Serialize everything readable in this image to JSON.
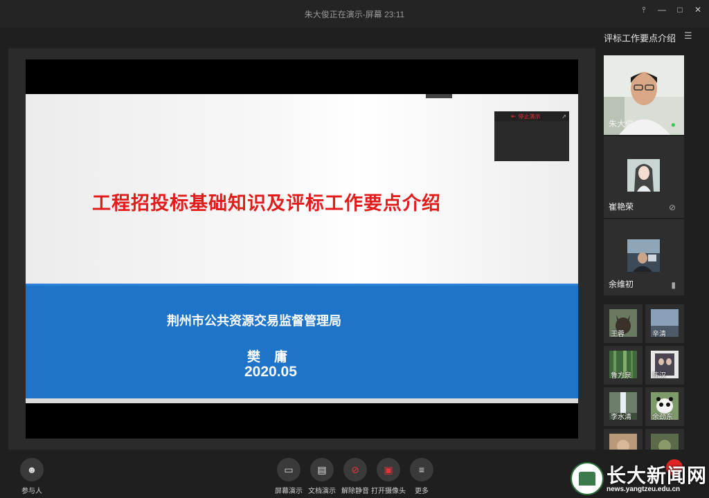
{
  "window": {
    "title": "朱大俊正在演示-屏幕 23:11"
  },
  "slide": {
    "title": "工程招投标基础知识及评标工作要点介绍",
    "organization": "荆州市公共资源交易监督管理局",
    "speaker": "樊庸",
    "date": "2020.05"
  },
  "stop_share": {
    "label": "停止演示"
  },
  "side_panel": {
    "title": "评标工作要点介绍",
    "main_participants": [
      {
        "name": "朱大俊",
        "mic": "active"
      },
      {
        "name": "崔艳荣",
        "mic": "muted"
      },
      {
        "name": "余维初",
        "mic": "on"
      }
    ],
    "small_participants": [
      "王蓉",
      "辛清",
      "鲁方泉",
      "陈汉",
      "李水清",
      "余劲东"
    ]
  },
  "toolbar": {
    "participants": "参与人",
    "screen_share": "屏幕演示",
    "doc_share": "文档演示",
    "unmute": "解除静音",
    "camera": "打开摄像头",
    "more": "更多"
  },
  "watermark": {
    "text": "长大新闻网",
    "url": "news.yangtzeu.edu.cn"
  }
}
